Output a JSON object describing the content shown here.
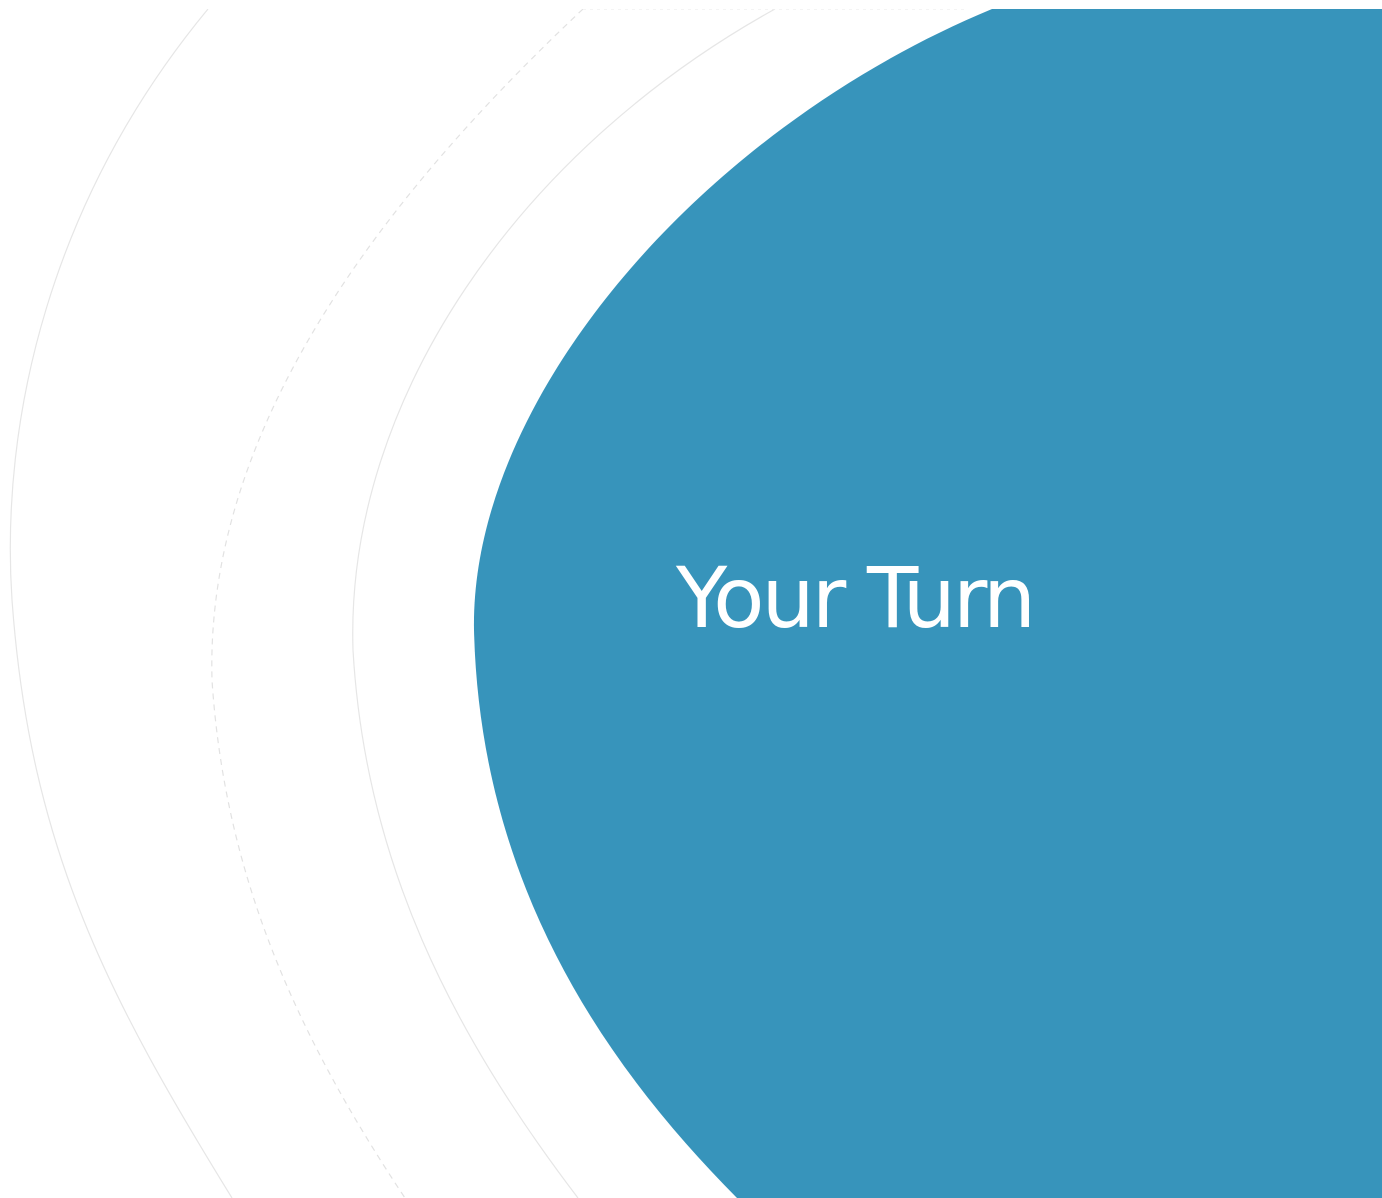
{
  "slide": {
    "title": "Your Turn"
  },
  "colors": {
    "background": "#ffffff",
    "accent": "#3794bb",
    "title_text": "#ffffff",
    "decor_line": "#e6e6e6"
  }
}
